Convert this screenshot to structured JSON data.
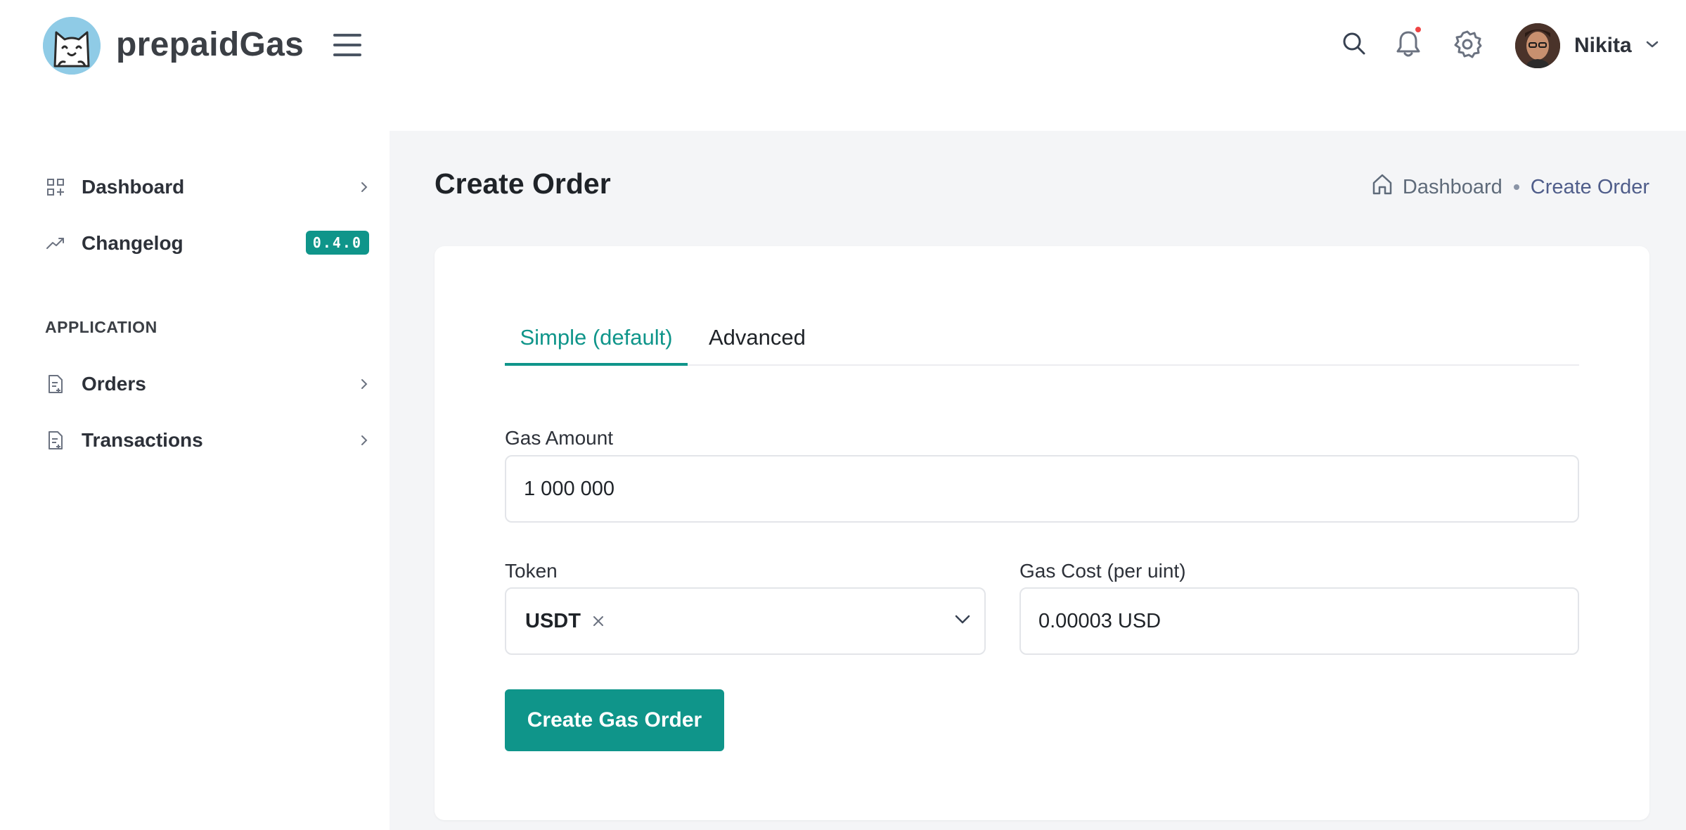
{
  "app": {
    "brand": "prepaidGas"
  },
  "header": {
    "user_name": "Nikita"
  },
  "sidebar": {
    "items": [
      {
        "label": "Dashboard",
        "icon": "grid-plus-icon"
      },
      {
        "label": "Changelog",
        "icon": "trend-up-icon",
        "badge": "0.4.0"
      }
    ],
    "section_title": "APPLICATION",
    "app_items": [
      {
        "label": "Orders",
        "icon": "document-icon"
      },
      {
        "label": "Transactions",
        "icon": "document-icon"
      }
    ]
  },
  "main": {
    "page_title": "Create Order",
    "breadcrumb": {
      "home": "Dashboard",
      "current": "Create Order"
    },
    "tabs": [
      {
        "label": "Simple (default)",
        "active": true
      },
      {
        "label": "Advanced",
        "active": false
      }
    ],
    "form": {
      "gas_amount_label": "Gas Amount",
      "gas_amount_value": "1 000 000",
      "token_label": "Token",
      "token_value": "USDT",
      "gas_cost_label": "Gas Cost (per uint)",
      "gas_cost_value": "0.00003 USD",
      "submit_label": "Create Gas Order"
    }
  },
  "colors": {
    "accent": "#0f958a",
    "notification_dot": "#ef4444",
    "main_bg": "#f4f5f7"
  }
}
